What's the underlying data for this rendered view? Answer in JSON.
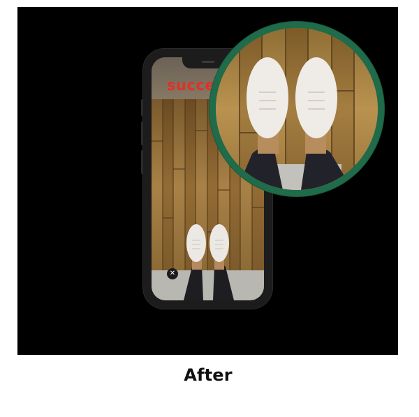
{
  "caption": "After",
  "phone_screen": {
    "status_text": "succe",
    "close_icon_glyph": "✕"
  },
  "colors": {
    "panel_background": "#000000",
    "magnifier_ring": "#1f6b4a",
    "status_text": "#e03127"
  },
  "icons": {
    "close": "close-icon",
    "magnifier": "magnifier-lens"
  }
}
